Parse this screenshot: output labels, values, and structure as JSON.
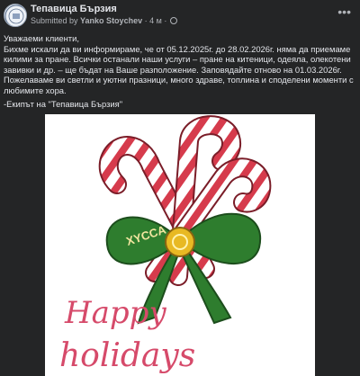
{
  "post": {
    "page_name": "Тепавица Бързия",
    "byline_prefix": "Submitted by",
    "author": "Yanko Stoychev",
    "time": "4 м",
    "separator": "·",
    "body_lines": [
      "Уважаеми клиенти,",
      "Бихме искали да ви информираме, че от 05.12.2025г. до 28.02.2026г. няма да приемаме килими за пране. Всички останали наши услуги – пране на китеници, одеяла, олекотени завивки и др. – ще бъдат на Ваше разположение. Заповядайте отново на 01.03.2026г.",
      "Пожелаваме ви светли и уютни празници, много здраве, топлина и споделени моменти с любимите хора."
    ],
    "signoff": "-Екипът на \"Тепавица Бързия\"",
    "image": {
      "greeting_line1": "Happy",
      "greeting_line2": "holidays",
      "ribbon_text": "XYCCA"
    }
  },
  "colors": {
    "background": "#242526",
    "text": "#e4e6eb",
    "secondary_text": "#b0b3b8",
    "candy_red": "#d63b4c",
    "ribbon_green": "#2e7d2e",
    "bell_gold": "#e8b923",
    "greeting_pink": "#d64a6a"
  },
  "icons": {
    "avatar": "page-logo-icon",
    "globe": "globe-icon",
    "more": "more-options-icon"
  }
}
